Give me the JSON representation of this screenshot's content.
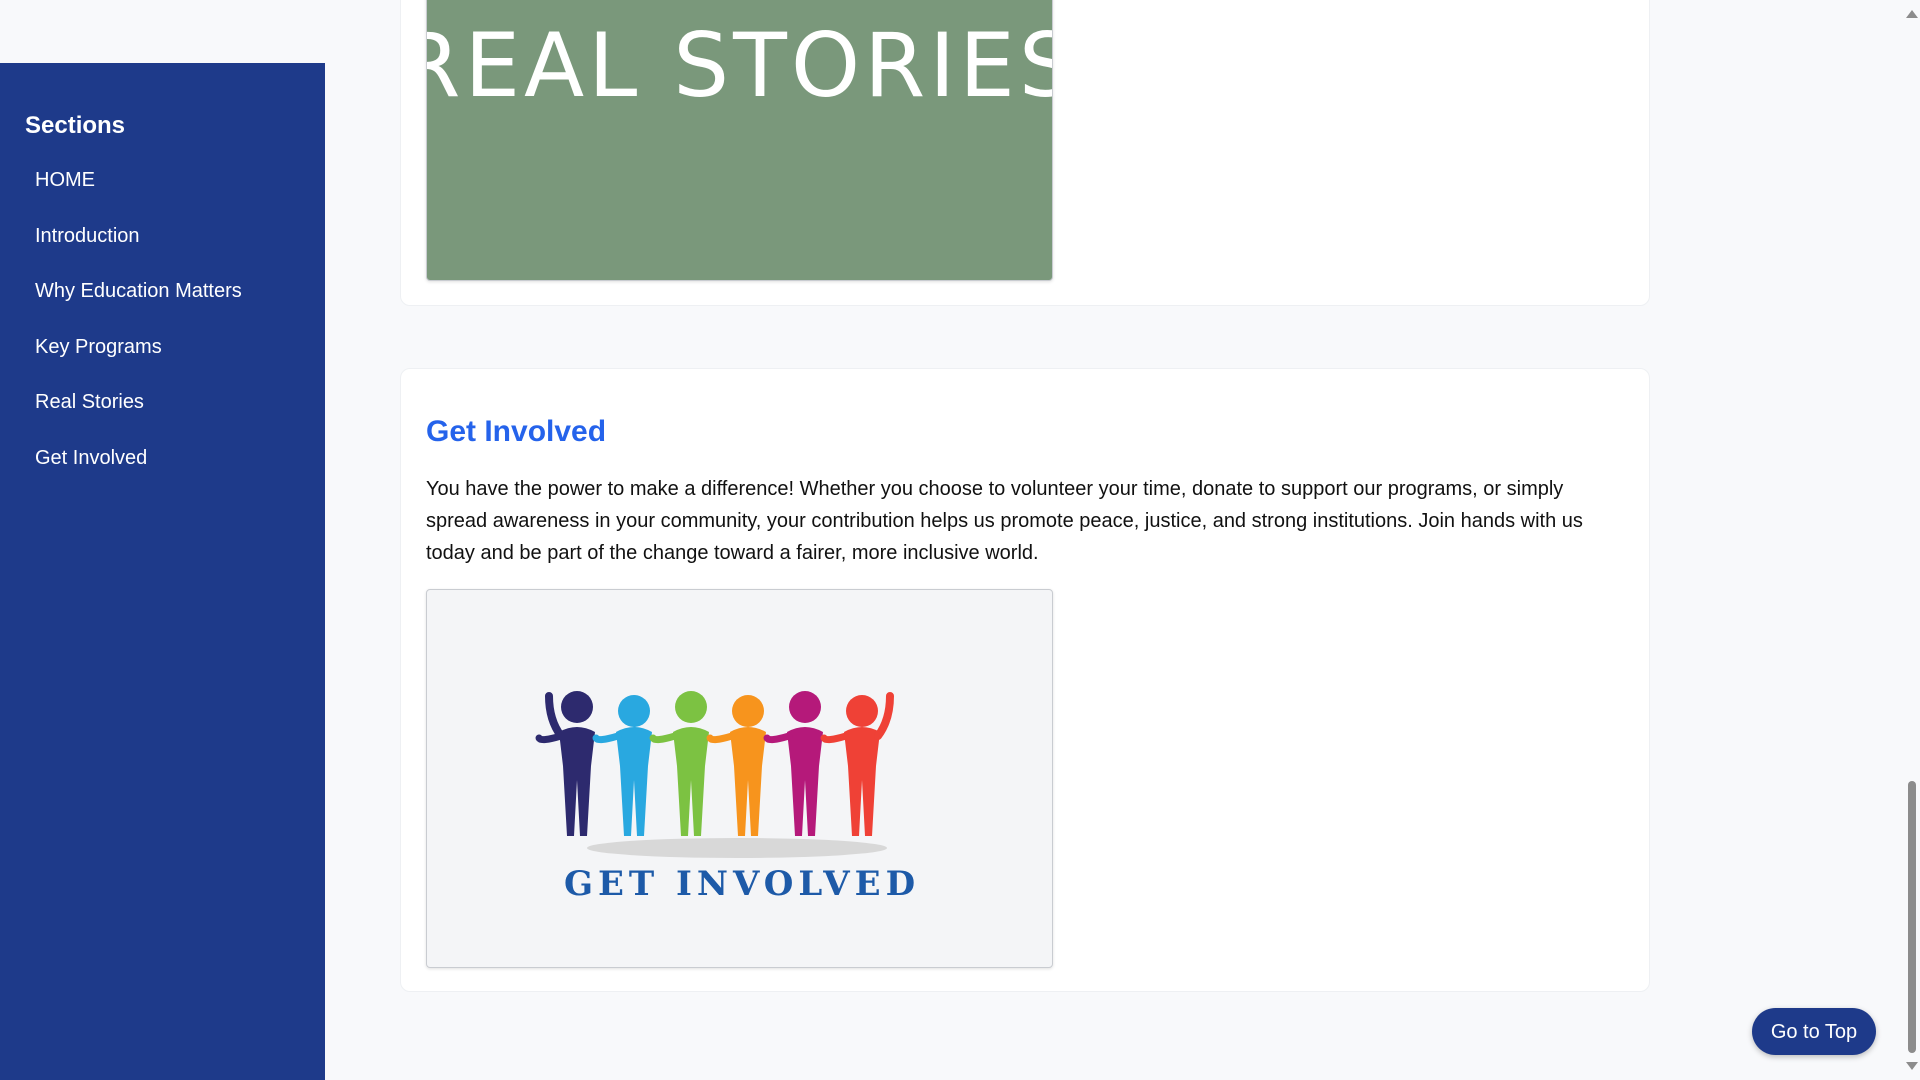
{
  "sidebar": {
    "title": "Sections",
    "items": [
      {
        "label": "HOME"
      },
      {
        "label": "Introduction"
      },
      {
        "label": "Why Education Matters"
      },
      {
        "label": "Key Programs"
      },
      {
        "label": "Real Stories"
      },
      {
        "label": "Get Involved"
      }
    ]
  },
  "real_stories_image": {
    "text": "REAL STORIES",
    "background": "#7a987b"
  },
  "get_involved": {
    "heading": "Get Involved",
    "text": "You have the power to make a difference! Whether you choose to volunteer your time, donate to support our programs, or simply spread awareness in your community, your contribution helps us promote peace, justice, and strong institutions. Join hands with us today and be part of the change toward a fairer, more inclusive world.",
    "image_text": "GET INVOLVED",
    "figure_colors": [
      "#2d2a6e",
      "#29a8e0",
      "#7cc242",
      "#f7941d",
      "#b5197a",
      "#ef4136"
    ]
  },
  "go_top": {
    "label": "Go to Top"
  },
  "colors": {
    "sidebar_bg": "#1e3a8a",
    "heading": "#2563eb",
    "button_bg": "#1e3a8a"
  }
}
